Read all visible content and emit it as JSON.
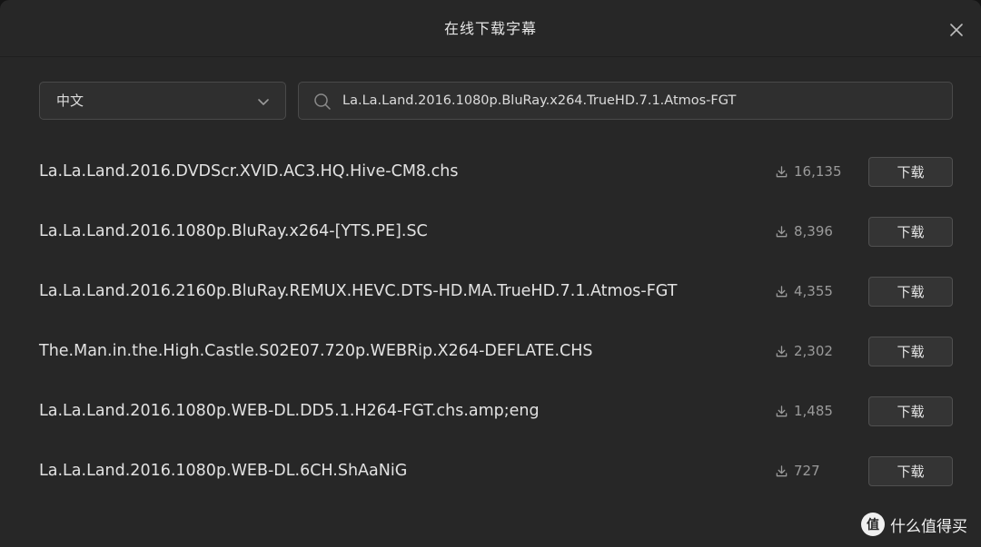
{
  "dialog": {
    "title": "在线下载字幕"
  },
  "language_select": {
    "selected": "中文"
  },
  "search": {
    "value": "La.La.Land.2016.1080p.BluRay.x264.TrueHD.7.1.Atmos-FGT"
  },
  "results": [
    {
      "name": "La.La.Land.2016.DVDScr.XVID.AC3.HQ.Hive-CM8.chs",
      "downloads": "16,135",
      "button": "下载"
    },
    {
      "name": "La.La.Land.2016.1080p.BluRay.x264-[YTS.PE].SC",
      "downloads": "8,396",
      "button": "下载"
    },
    {
      "name": "La.La.Land.2016.2160p.BluRay.REMUX.HEVC.DTS-HD.MA.TrueHD.7.1.Atmos-FGT",
      "downloads": "4,355",
      "button": "下载"
    },
    {
      "name": "The.Man.in.the.High.Castle.S02E07.720p.WEBRip.X264-DEFLATE.CHS",
      "downloads": "2,302",
      "button": "下载"
    },
    {
      "name": "La.La.Land.2016.1080p.WEB-DL.DD5.1.H264-FGT.chs.amp;eng",
      "downloads": "1,485",
      "button": "下载"
    },
    {
      "name": "La.La.Land.2016.1080p.WEB-DL.6CH.ShAaNiG",
      "downloads": "727",
      "button": "下载"
    }
  ],
  "watermark": {
    "logo": "值",
    "text": "什么值得买"
  },
  "icons": {
    "close": "close-icon",
    "chevron": "chevron-down-icon",
    "search": "search-icon",
    "download": "download-icon"
  },
  "colors": {
    "background": "#272727",
    "border": "#4a4a4a",
    "text": "#e2e2e2",
    "muted": "#9a9a9a"
  }
}
